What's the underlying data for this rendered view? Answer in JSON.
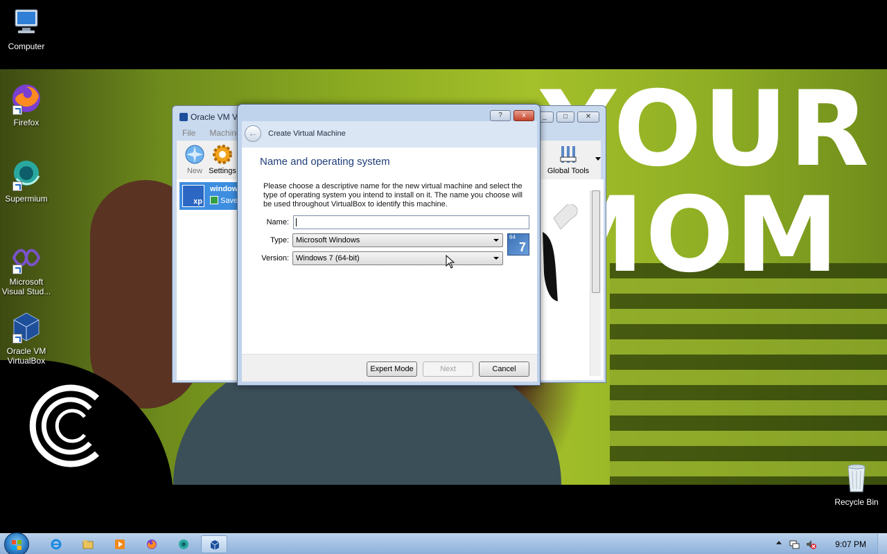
{
  "desktop": {
    "icons": [
      {
        "label": "Computer"
      },
      {
        "label": "Firefox"
      },
      {
        "label": "Supermium"
      },
      {
        "label": "Microsoft Visual Stud..."
      },
      {
        "label": "Oracle VM VirtualBox"
      }
    ],
    "recycle_bin": "Recycle Bin",
    "wallpaper_text": {
      "line1": "YOUR",
      "line2": "MOM"
    }
  },
  "vbox_manager": {
    "title": "Oracle VM V",
    "menu": [
      "File",
      "Machine"
    ],
    "toolbar": {
      "new": "New",
      "settings": "Settings",
      "global_tools": "Global Tools"
    },
    "vm_list": [
      {
        "name": "window",
        "state": "Save",
        "os_badge": "xp"
      }
    ]
  },
  "dialog": {
    "title": "Create Virtual Machine",
    "help_button": "?",
    "close_button": "x",
    "section_title": "Name and operating system",
    "description": "Please choose a descriptive name for the new virtual machine and select the type of operating system you intend to install on it. The name you choose will be used throughout VirtualBox to identify this machine.",
    "fields": {
      "name_label": "Name:",
      "name_value": "",
      "type_label": "Type:",
      "type_value": "Microsoft Windows",
      "version_label": "Version:",
      "version_value": "Windows 7 (64-bit)"
    },
    "os_icon": {
      "bits": "64",
      "version": "7"
    },
    "buttons": {
      "expert": "Expert Mode",
      "next": "Next",
      "cancel": "Cancel"
    }
  },
  "taskbar": {
    "clock": "9:07 PM",
    "apps": [
      "Internet Explorer",
      "File Explorer",
      "Windows Media Player",
      "Firefox",
      "Supermium",
      "Oracle VM VirtualBox"
    ]
  },
  "colors": {
    "accent": "#3d8ee0",
    "section_title": "#1e3c78",
    "wallpaper_green": "#8cab22"
  }
}
